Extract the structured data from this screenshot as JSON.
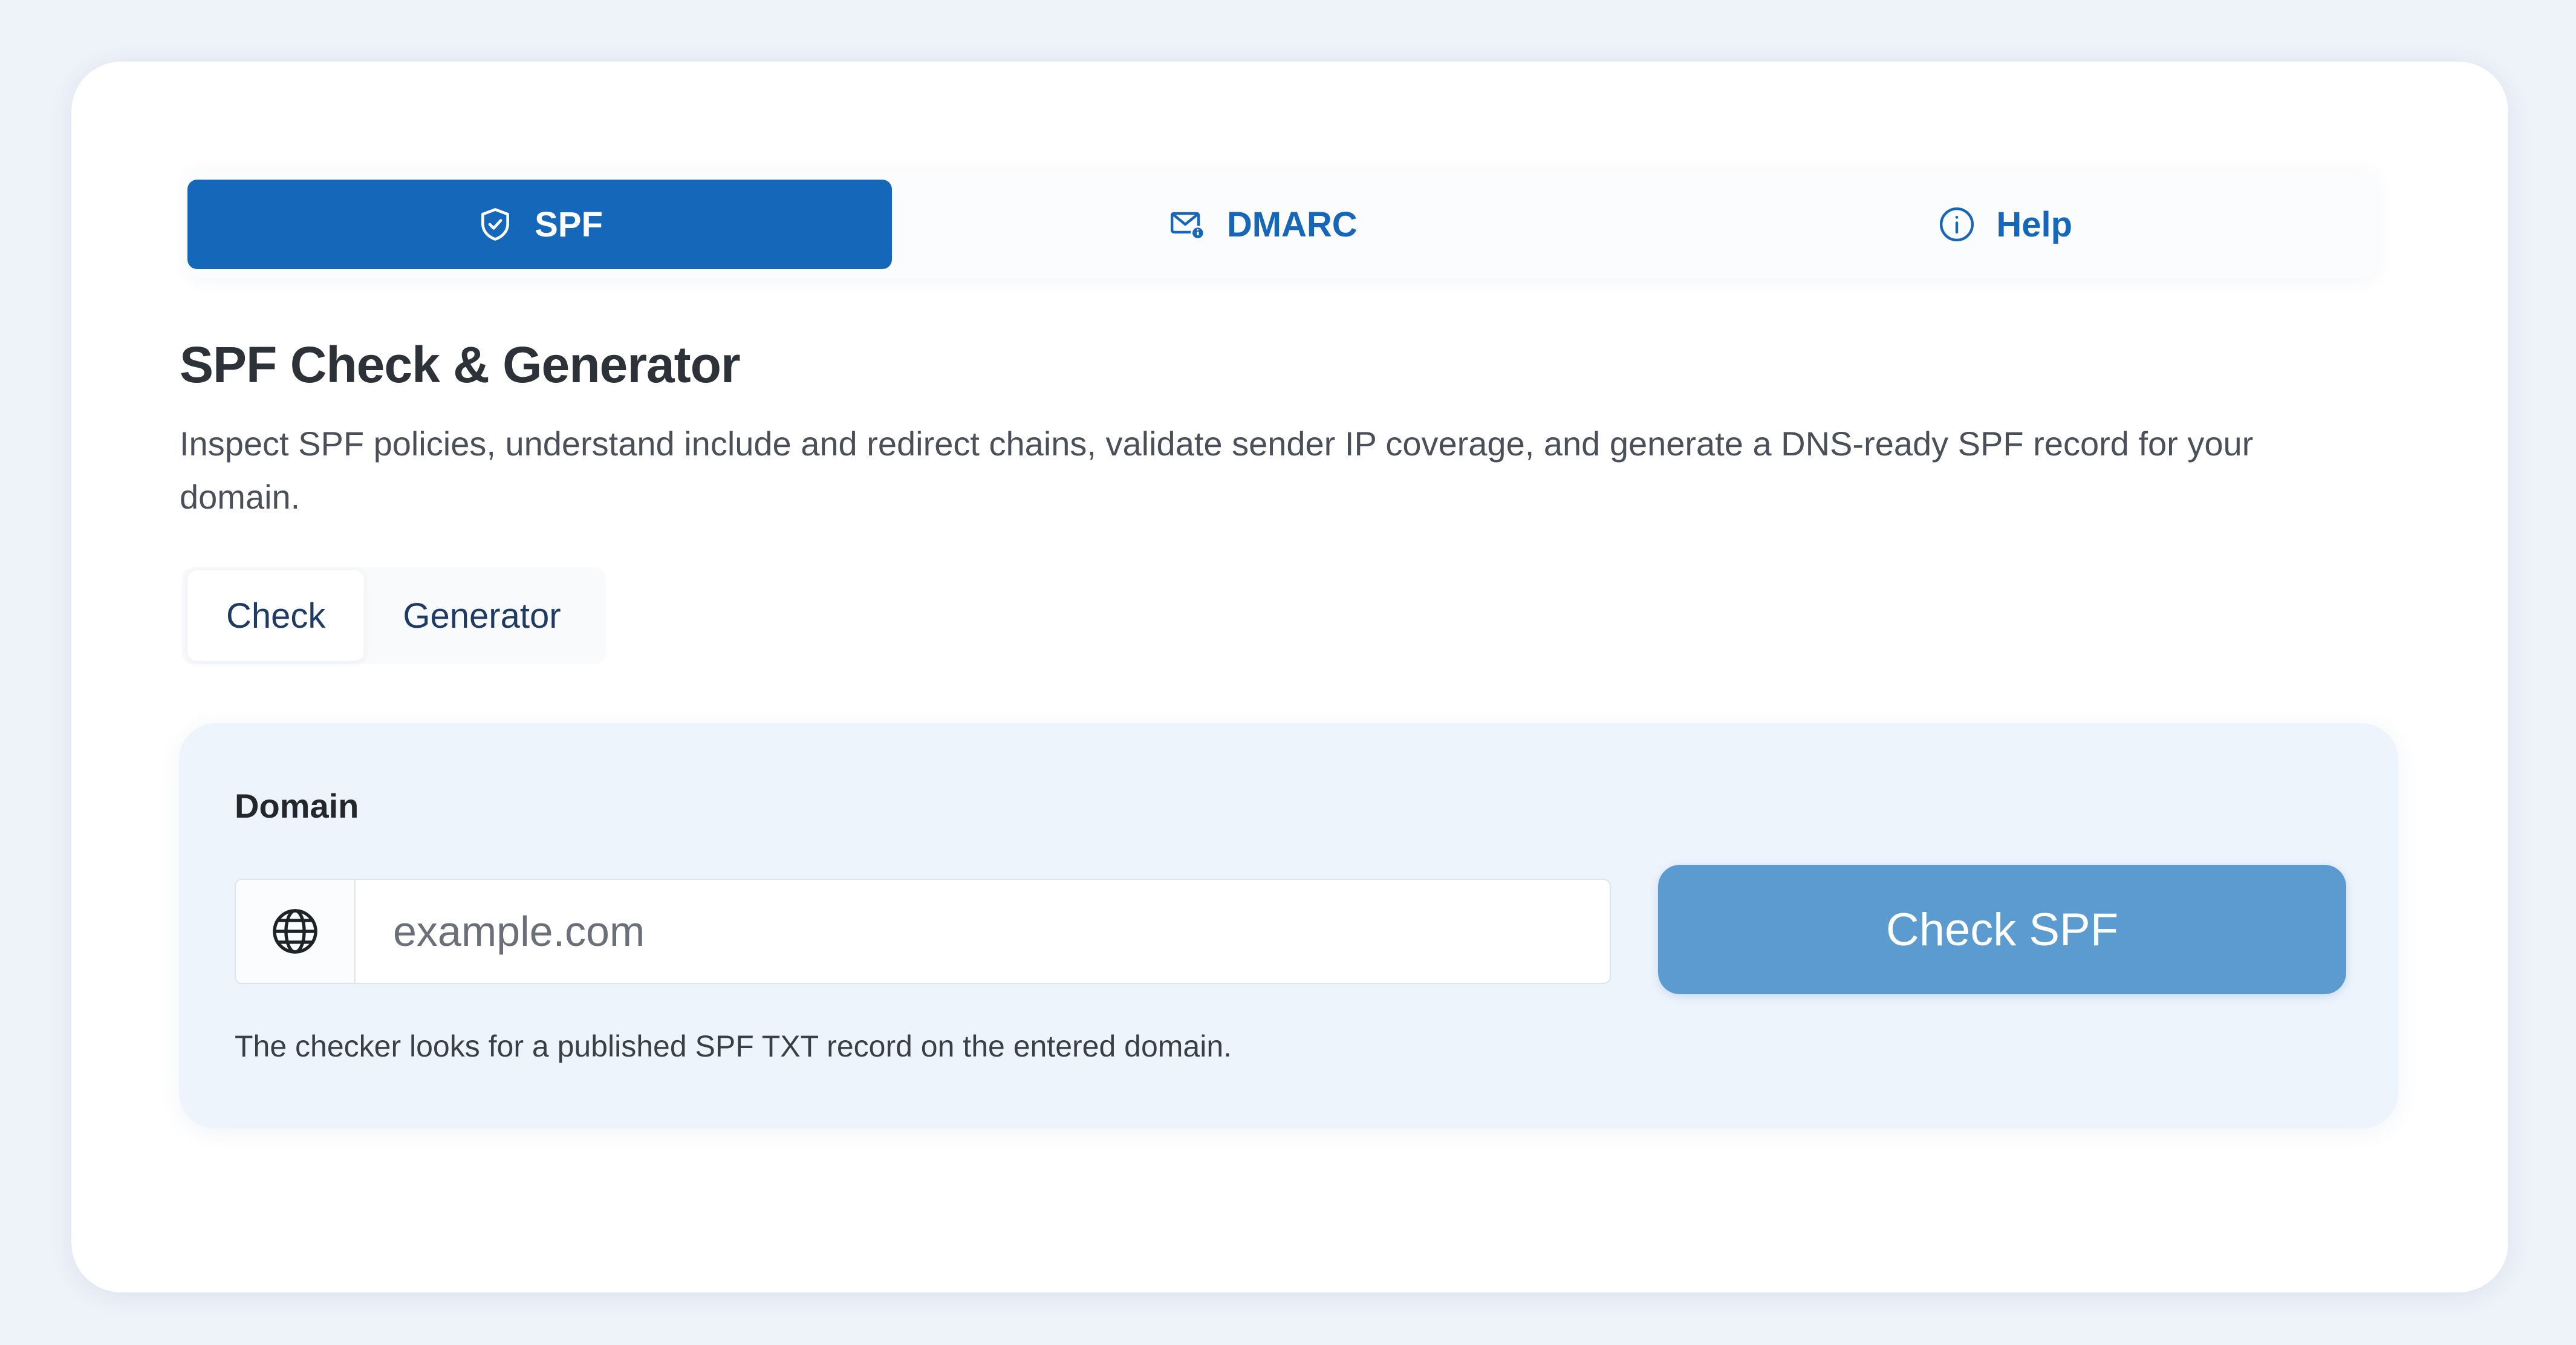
{
  "tabs": [
    {
      "label": "SPF",
      "icon": "shield-check-icon",
      "active": true
    },
    {
      "label": "DMARC",
      "icon": "envelope-info-icon",
      "active": false
    },
    {
      "label": "Help",
      "icon": "info-circle-icon",
      "active": false
    }
  ],
  "page": {
    "title": "SPF Check & Generator",
    "description": "Inspect SPF policies, understand include and redirect chains, validate sender IP coverage, and generate a DNS-ready SPF record for your domain."
  },
  "subtabs": [
    {
      "label": "Check",
      "active": true
    },
    {
      "label": "Generator",
      "active": false
    }
  ],
  "form": {
    "label": "Domain",
    "input_value": "",
    "placeholder": "example.com",
    "prefix_icon": "globe-icon",
    "button_label": "Check SPF",
    "hint": "The checker looks for a published SPF TXT record on the entered domain."
  },
  "colors": {
    "accent": "#1567ba",
    "button": "#5b9bd0",
    "background": "#eef2f9"
  }
}
